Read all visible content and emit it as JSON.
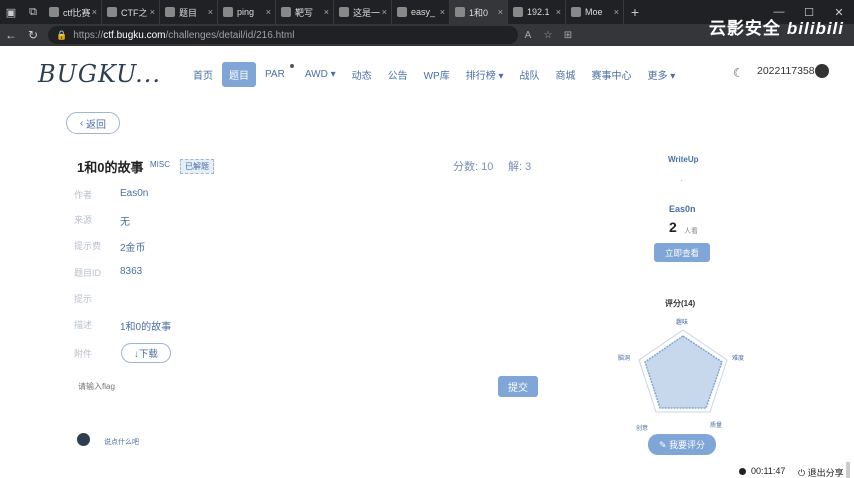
{
  "browser": {
    "tabs": [
      {
        "label": "ctf比赛"
      },
      {
        "label": "CTF之"
      },
      {
        "label": "题目"
      },
      {
        "label": "ping"
      },
      {
        "label": "靶写"
      },
      {
        "label": "这是一"
      },
      {
        "label": "easy_"
      },
      {
        "label": "1和0"
      },
      {
        "label": "192.1"
      },
      {
        "label": "Moe"
      }
    ],
    "active_tab": 7,
    "url_host": "ctf.bugku.com",
    "url_path": "/challenges/detail/id/216.html",
    "url_prefix": "https://",
    "watermark": "云影安全",
    "watermark_bili": "bilibili"
  },
  "site": {
    "logo": "BUGKU...",
    "nav": [
      {
        "label": "首页"
      },
      {
        "label": "题目"
      },
      {
        "label": "PAR"
      },
      {
        "label": "AWD ▾"
      },
      {
        "label": "动态"
      },
      {
        "label": "公告"
      },
      {
        "label": "WP库"
      },
      {
        "label": "排行榜 ▾"
      },
      {
        "label": "战队"
      },
      {
        "label": "商城"
      },
      {
        "label": "赛事中心"
      },
      {
        "label": "更多 ▾"
      }
    ],
    "active_nav": 1,
    "username": "2022117358"
  },
  "challenge": {
    "back_label": "返回",
    "title": "1和0的故事",
    "category": "MISC",
    "tag": "已解题",
    "score_label": "分数: 10",
    "solved_label": "解: 3",
    "author_label": "作者",
    "author": "Eas0n",
    "field2_label": "来源",
    "field2": "无",
    "cost_label": "提示费",
    "cost": "2金币",
    "id_label": "题目ID",
    "id": "8363",
    "hint_label": "提示",
    "hint": "",
    "desc_label": "描述",
    "desc": "1和0的故事",
    "file_label": "附件",
    "download_label": "↓下载",
    "flag_placeholder": "请输入flag",
    "submit_label": "提交",
    "comment_placeholder": "说点什么吧"
  },
  "sidebar": {
    "writeup_title": "WriteUp",
    "writeup_author": "Eas0n",
    "writeup_count": "2",
    "writeup_unit": "人看",
    "writeup_btn": "立即查看",
    "rating_title": "评分(14)",
    "radar_labels": [
      "趣味",
      "难度",
      "质量",
      "创意",
      "脑洞"
    ],
    "rate_btn": "✎ 我要评分"
  },
  "recording": {
    "time": "00:11:47",
    "exit_label": "退出分享"
  }
}
